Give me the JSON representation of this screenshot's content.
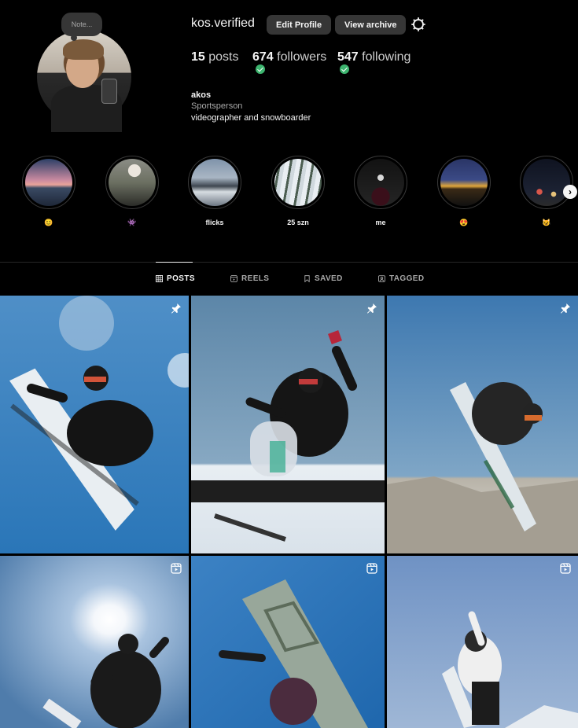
{
  "profile": {
    "note": "Note...",
    "username": "kos.verified",
    "edit_profile": "Edit Profile",
    "view_archive": "View archive",
    "stats": {
      "posts_count": "15",
      "posts_label": "posts",
      "followers_count": "674",
      "followers_label": "followers",
      "following_count": "547",
      "following_label": "following"
    },
    "bio": {
      "name": "akos",
      "category": "Sportsperson",
      "text": "videographer and snowboarder"
    }
  },
  "highlights": [
    {
      "label": "😊",
      "icon": "sunset-lake"
    },
    {
      "label": "👾",
      "icon": "camera-crew"
    },
    {
      "label": "flicks",
      "icon": "mountains"
    },
    {
      "label": "25 szn",
      "icon": "snowy-trees"
    },
    {
      "label": "me",
      "icon": "night-figure"
    },
    {
      "label": "😍",
      "icon": "lit-house"
    },
    {
      "label": "😺",
      "icon": "night-city"
    }
  ],
  "tabs": [
    {
      "label": "POSTS",
      "icon": "grid-icon",
      "active": true
    },
    {
      "label": "REELS",
      "icon": "reels-icon",
      "active": false
    },
    {
      "label": "SAVED",
      "icon": "bookmark-icon",
      "active": false
    },
    {
      "label": "TAGGED",
      "icon": "tag-icon",
      "active": false
    }
  ],
  "posts": [
    {
      "badge": "pin-icon",
      "subject": "snowboarder jump blue sky"
    },
    {
      "badge": "pin-icon",
      "subject": "snowboarder rail"
    },
    {
      "badge": "pin-icon",
      "subject": "snowboarder grab"
    },
    {
      "badge": "reel-icon",
      "subject": "snowboarder sun"
    },
    {
      "badge": "reel-icon",
      "subject": "snowboard board closeup"
    },
    {
      "badge": "reel-icon",
      "subject": "snowboarder white jacket"
    }
  ],
  "colors": {
    "background": "#000000",
    "button": "#363636",
    "verified_check": "#3db56f",
    "muted_text": "#a8a8a8"
  }
}
